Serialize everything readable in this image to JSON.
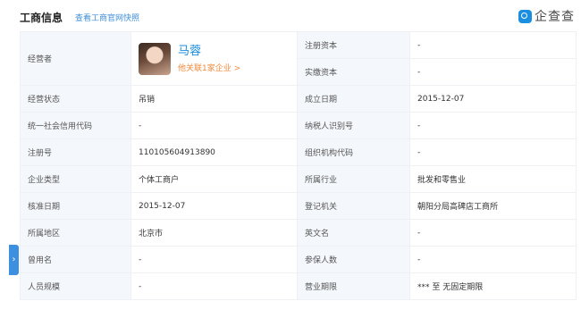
{
  "header": {
    "title": "工商信息",
    "snapshot_link": "查看工商官网快照",
    "brand": "企查查",
    "brand_icon": "qichacha-logo-icon",
    "accent_color": "#1a8ee0"
  },
  "owner": {
    "label": "经营者",
    "name": "马蓉",
    "related_link": "他关联1家企业 >"
  },
  "right_top": [
    {
      "label": "注册资本",
      "value": "-"
    },
    {
      "label": "实缴资本",
      "value": "-"
    }
  ],
  "rows": [
    {
      "l1": "经营状态",
      "v1": "吊销",
      "l2": "成立日期",
      "v2": "2015-12-07"
    },
    {
      "l1": "统一社会信用代码",
      "v1": "-",
      "l2": "纳税人识别号",
      "v2": "-"
    },
    {
      "l1": "注册号",
      "v1": "110105604913890",
      "l2": "组织机构代码",
      "v2": "-"
    },
    {
      "l1": "企业类型",
      "v1": "个体工商户",
      "l2": "所属行业",
      "v2": "批发和零售业"
    },
    {
      "l1": "核准日期",
      "v1": "2015-12-07",
      "l2": "登记机关",
      "v2": "朝阳分局高碑店工商所"
    },
    {
      "l1": "所属地区",
      "v1": "北京市",
      "l2": "英文名",
      "v2": "-"
    },
    {
      "l1": "曾用名",
      "v1": "-",
      "l2": "参保人数",
      "v2": "-"
    },
    {
      "l1": "人员规模",
      "v1": "-",
      "l2": "营业期限",
      "v2": "*** 至 无固定期限"
    }
  ],
  "side_tab_icon": "chevron-right-icon"
}
